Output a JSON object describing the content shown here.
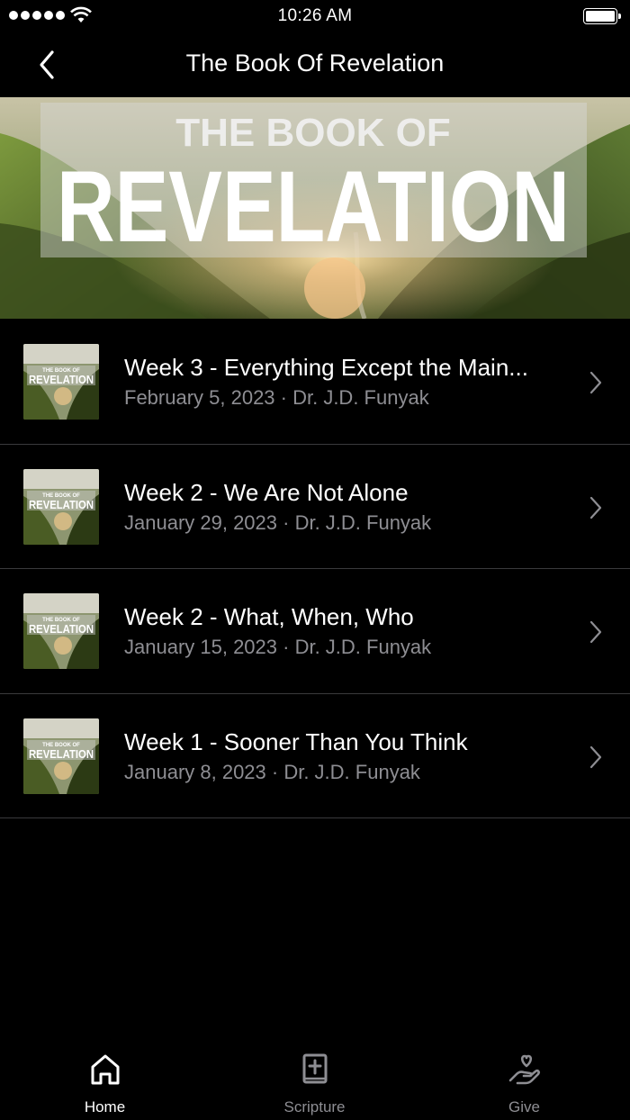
{
  "status_bar": {
    "time": "10:26 AM"
  },
  "nav": {
    "title": "The Book Of Revelation",
    "back_icon": "chevron-left-icon"
  },
  "banner": {
    "line1": "THE BOOK OF",
    "line2": "REVELATION"
  },
  "thumbnail": {
    "line1": "THE BOOK OF",
    "line2": "REVELATION"
  },
  "sermons": [
    {
      "title": "Week 3 - Everything Except the Main...",
      "meta": "February 5, 2023 · Dr. J.D. Funyak"
    },
    {
      "title": "Week 2 - We Are Not Alone",
      "meta": "January 29, 2023 · Dr. J.D. Funyak"
    },
    {
      "title": "Week 2 - What, When, Who",
      "meta": "January 15, 2023 · Dr. J.D. Funyak"
    },
    {
      "title": "Week 1 - Sooner Than You Think",
      "meta": "January 8, 2023 · Dr. J.D. Funyak"
    }
  ],
  "tabs": [
    {
      "label": "Home",
      "icon": "home-icon",
      "active": true
    },
    {
      "label": "Scripture",
      "icon": "bible-icon",
      "active": false
    },
    {
      "label": "Give",
      "icon": "give-hand-heart-icon",
      "active": false
    }
  ],
  "colors": {
    "background": "#000000",
    "text": "#ffffff",
    "secondary_text": "#8e8e93",
    "divider": "#3a3a3c"
  }
}
